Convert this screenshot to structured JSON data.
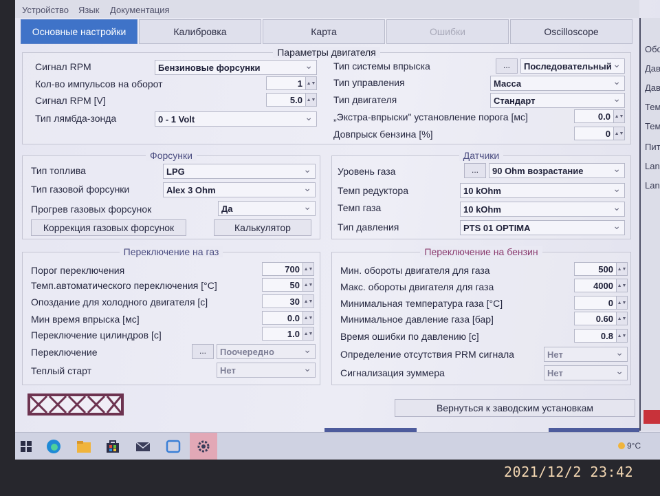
{
  "menu": [
    "Устройство",
    "Язык",
    "Документация"
  ],
  "tabs": [
    {
      "label": "Основные настройки",
      "state": "active"
    },
    {
      "label": "Калибровка",
      "state": "normal"
    },
    {
      "label": "Карта",
      "state": "normal"
    },
    {
      "label": "Ошибки",
      "state": "disabled"
    },
    {
      "label": "Oscilloscope",
      "state": "normal"
    }
  ],
  "engine": {
    "title": "Параметры двигателя",
    "rpm_signal_label": "Сигнал RPM",
    "rpm_signal_value": "Бензиновые форсунки",
    "pulses_label": "Кол-во импульсов на оборот",
    "pulses_value": "1",
    "rpm_v_label": "Сигнал RPM [V]",
    "rpm_v_value": "5.0",
    "lambda_label": "Тип лямбда-зонда",
    "lambda_value": "0 - 1 Volt",
    "injection_type_label": "Тип системы впрыска",
    "injection_type_value": "Последовательный",
    "control_type_label": "Тип управления",
    "control_type_value": "Масса",
    "engine_type_label": "Тип двигателя",
    "engine_type_value": "Стандарт",
    "extra_label": "„Экстра-впрыски\" установление порога [мс]",
    "extra_value": "0.0",
    "petrol_label": "Довпрыск бензина [%]",
    "petrol_value": "0"
  },
  "injectors": {
    "title": "Форсунки",
    "fuel_type_label": "Тип топлива",
    "fuel_type_value": "LPG",
    "injector_type_label": "Тип газовой форсунки",
    "injector_type_value": "Alex 3 Ohm",
    "heating_label": "Прогрев газовых форсунок",
    "heating_value": "Да",
    "correction_button": "Коррекция газовых форсунок",
    "calculator_button": "Калькулятор"
  },
  "sensors": {
    "title": "Датчики",
    "gas_level_label": "Уровень газа",
    "gas_level_value": "90 Ohm возрастание",
    "reducer_temp_label": "Темп редуктора",
    "reducer_temp_value": "10 kOhm",
    "gas_temp_label": "Темп газа",
    "gas_temp_value": "10 kOhm",
    "pressure_type_label": "Тип давления",
    "pressure_type_value": "PTS 01 OPTIMA"
  },
  "switch_gas": {
    "title": "Переключение на газ",
    "threshold_label": "Порог переключения",
    "threshold_value": "700",
    "auto_temp_label": "Темп.автоматического переключения [°C]",
    "auto_temp_value": "50",
    "cold_delay_label": "Опоздание для холодного двигателя  [c]",
    "cold_delay_value": "30",
    "min_inj_label": "Мин время впрыска [мс]",
    "min_inj_value": "0.0",
    "cyl_switch_label": "Переключение цилиндров [c]",
    "cyl_switch_value": "1.0",
    "switching_label": "Переключение",
    "switching_value": "Поочередно",
    "warm_start_label": "Теплый старт",
    "warm_start_value": "Нет"
  },
  "switch_petrol": {
    "title": "Переключение на бензин",
    "min_rpm_label": "Мин. обороты двигателя для газа",
    "min_rpm_value": "500",
    "max_rpm_label": "Макс. обороты двигателя для газа",
    "max_rpm_value": "4000",
    "min_temp_label": "Минимальная температура газа  [°C]",
    "min_temp_value": "0",
    "min_press_label": "Минимальное давление газа  [бар]",
    "min_press_value": "0.60",
    "err_time_label": "Время ошибки по давлению [c]",
    "err_time_value": "0.8",
    "prm_label": "Определение отсутствия PRM сигнала",
    "prm_value": "Нет",
    "buzzer_label": "Сигнализация зуммера",
    "buzzer_value": "Нет"
  },
  "factory_reset_button": "Вернуться к заводским установкам",
  "dots_label": "...",
  "right_panel": [
    "Обо",
    "Дав",
    "Дав",
    "Тем",
    "Тем",
    "Пит",
    "Lan",
    "Lan"
  ],
  "taskbar": {
    "weather": "9°C"
  },
  "timestamp": "2021/12/2  23:42",
  "colors": {
    "active_tab": "#3f73c8",
    "petrol_title": "#8a3b6e",
    "gas_title": "#4a4c80"
  }
}
